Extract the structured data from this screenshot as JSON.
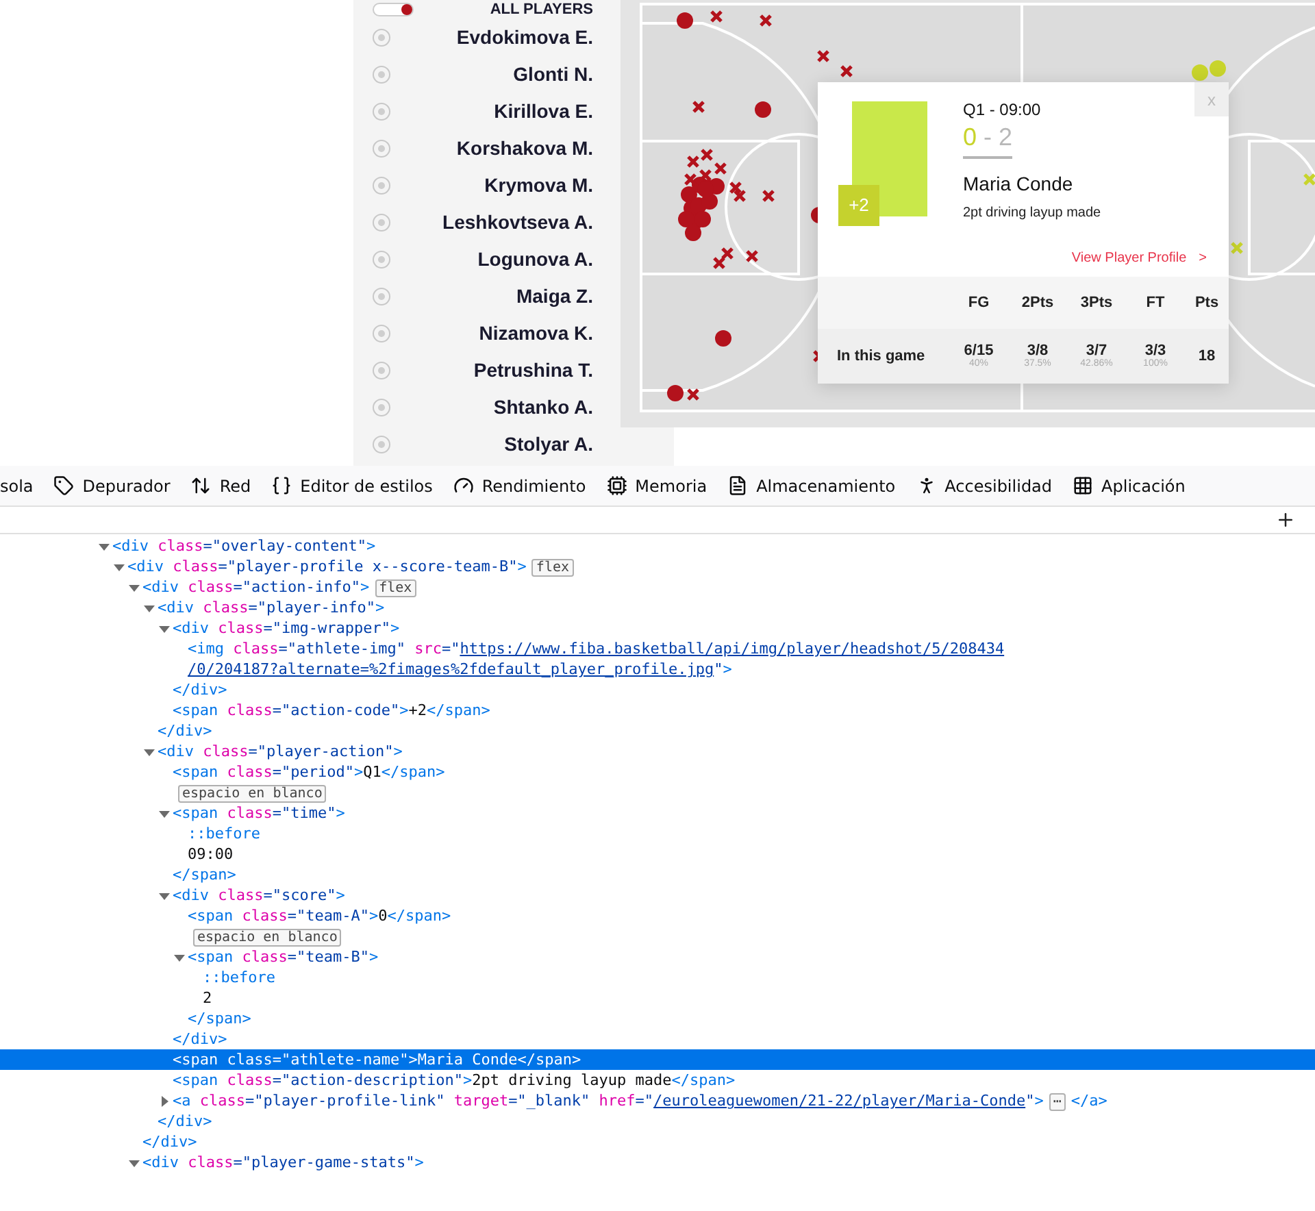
{
  "sidebar": {
    "all_players": {
      "label": "ALL PLAYERS",
      "on": true
    },
    "players": [
      {
        "name": "Evdokimova E.",
        "selected": false
      },
      {
        "name": "Glonti N.",
        "selected": false
      },
      {
        "name": "Kirillova E.",
        "selected": false
      },
      {
        "name": "Korshakova M.",
        "selected": false
      },
      {
        "name": "Krymova M.",
        "selected": false
      },
      {
        "name": "Leshkovtseva A.",
        "selected": false
      },
      {
        "name": "Logunova A.",
        "selected": false
      },
      {
        "name": "Maiga Z.",
        "selected": false
      },
      {
        "name": "Nizamova K.",
        "selected": false
      },
      {
        "name": "Petrushina T.",
        "selected": false
      },
      {
        "name": "Shtanko A.",
        "selected": false
      },
      {
        "name": "Stolyar A.",
        "selected": false
      }
    ]
  },
  "popup": {
    "close": "x",
    "period_time": "Q1 - 09:00",
    "score": {
      "team_a": "0",
      "separator": "-",
      "team_b": "2"
    },
    "action_code": "+2",
    "athlete_name": "Maria Conde",
    "description": "2pt driving layup made",
    "link": "View Player Profile",
    "link_arrow": ">",
    "stats": {
      "columns": [
        "FG",
        "2Pts",
        "3Pts",
        "FT",
        "Pts"
      ],
      "row_label": "In this game",
      "cells": [
        {
          "value": "6/15",
          "pct": "40%"
        },
        {
          "value": "3/8",
          "pct": "37.5%"
        },
        {
          "value": "3/7",
          "pct": "42.86%"
        },
        {
          "value": "3/3",
          "pct": "100%"
        },
        {
          "value": "18"
        }
      ]
    }
  },
  "devtools": {
    "tabs": [
      {
        "label": "sola"
      },
      {
        "label": "Depurador"
      },
      {
        "label": "Red"
      },
      {
        "label": "Editor de estilos"
      },
      {
        "label": "Rendimiento"
      },
      {
        "label": "Memoria"
      },
      {
        "label": "Almacenamiento"
      },
      {
        "label": "Accesibilidad"
      },
      {
        "label": "Aplicación"
      }
    ],
    "markup": {
      "expanded": true,
      "selected": false,
      "parts": [
        {
          "kind": "tag",
          "text": "<div"
        },
        {
          "kind": "attr",
          "text": " class"
        },
        {
          "kind": "value",
          "text": "=\"overlay-content\""
        },
        {
          "kind": "tag",
          "text": ">"
        }
      ],
      "children": [
        {
          "expanded": true,
          "selected": false,
          "parts": [
            {
              "kind": "tag",
              "text": "<div"
            },
            {
              "kind": "attr",
              "text": " class"
            },
            {
              "kind": "value",
              "text": "=\"player-profile x--score-team-B\""
            },
            {
              "kind": "tag",
              "text": ">"
            }
          ],
          "badge": "flex",
          "children": [
            {
              "expanded": true,
              "selected": false,
              "parts": [
                {
                  "kind": "tag",
                  "text": "<div"
                },
                {
                  "kind": "attr",
                  "text": " class"
                },
                {
                  "kind": "value",
                  "text": "=\"action-info\""
                },
                {
                  "kind": "tag",
                  "text": ">"
                }
              ],
              "badge": "flex",
              "children": [
                {
                  "expanded": true,
                  "selected": false,
                  "parts": [
                    {
                      "kind": "tag",
                      "text": "<div"
                    },
                    {
                      "kind": "attr",
                      "text": " class"
                    },
                    {
                      "kind": "value",
                      "text": "=\"player-info\""
                    },
                    {
                      "kind": "tag",
                      "text": ">"
                    }
                  ],
                  "children": [
                    {
                      "expanded": true,
                      "selected": false,
                      "parts": [
                        {
                          "kind": "tag",
                          "text": "<div"
                        },
                        {
                          "kind": "attr",
                          "text": " class"
                        },
                        {
                          "kind": "value",
                          "text": "=\"img-wrapper\""
                        },
                        {
                          "kind": "tag",
                          "text": ">"
                        }
                      ],
                      "children": [
                        {
                          "selected": false,
                          "parts": [
                            {
                              "kind": "tag",
                              "text": "<img"
                            },
                            {
                              "kind": "attr",
                              "text": " class"
                            },
                            {
                              "kind": "value",
                              "text": "=\"athlete-img\""
                            },
                            {
                              "kind": "attr",
                              "text": " src"
                            },
                            {
                              "kind": "value",
                              "text": "=\""
                            },
                            {
                              "kind": "link",
                              "text": "https://www.fiba.basketball/api/img/player/headshot/5/208434"
                            },
                            {
                              "kind": "link",
                              "new_line": true,
                              "text": "/0/204187?alternate=%2fimages%2fdefault_player_profile.jpg"
                            },
                            {
                              "kind": "value",
                              "text": "\""
                            },
                            {
                              "kind": "tag",
                              "text": ">"
                            }
                          ]
                        }
                      ],
                      "closing": {
                        "selected": false,
                        "parts": [
                          {
                            "kind": "tag",
                            "text": "</div>"
                          }
                        ]
                      }
                    },
                    {
                      "selected": false,
                      "parts": [
                        {
                          "kind": "tag",
                          "text": "<span"
                        },
                        {
                          "kind": "attr",
                          "text": " class"
                        },
                        {
                          "kind": "value",
                          "text": "=\"action-code\""
                        },
                        {
                          "kind": "tag",
                          "text": ">"
                        },
                        {
                          "kind": "text",
                          "text": "+2"
                        },
                        {
                          "kind": "tag",
                          "text": "</span>"
                        }
                      ]
                    }
                  ],
                  "closing": {
                    "selected": false,
                    "parts": [
                      {
                        "kind": "tag",
                        "text": "</div>"
                      }
                    ]
                  }
                },
                {
                  "expanded": true,
                  "selected": false,
                  "parts": [
                    {
                      "kind": "tag",
                      "text": "<div"
                    },
                    {
                      "kind": "attr",
                      "text": " class"
                    },
                    {
                      "kind": "value",
                      "text": "=\"player-action\""
                    },
                    {
                      "kind": "tag",
                      "text": ">"
                    }
                  ],
                  "children": [
                    {
                      "selected": false,
                      "parts": [
                        {
                          "kind": "tag",
                          "text": "<span"
                        },
                        {
                          "kind": "attr",
                          "text": " class"
                        },
                        {
                          "kind": "value",
                          "text": "=\"period\""
                        },
                        {
                          "kind": "tag",
                          "text": ">"
                        },
                        {
                          "kind": "text",
                          "text": "Q1"
                        },
                        {
                          "kind": "tag",
                          "text": "</span>"
                        }
                      ]
                    },
                    {
                      "selected": false,
                      "badge": "espacio en blanco"
                    },
                    {
                      "expanded": true,
                      "selected": false,
                      "parts": [
                        {
                          "kind": "tag",
                          "text": "<span"
                        },
                        {
                          "kind": "attr",
                          "text": " class"
                        },
                        {
                          "kind": "value",
                          "text": "=\"time\""
                        },
                        {
                          "kind": "tag",
                          "text": ">"
                        }
                      ],
                      "children": [
                        {
                          "selected": false,
                          "parts": [
                            {
                              "kind": "pseudo",
                              "text": "::before"
                            }
                          ]
                        },
                        {
                          "selected": false,
                          "parts": [
                            {
                              "kind": "text",
                              "text": "09:00"
                            }
                          ]
                        }
                      ],
                      "closing": {
                        "selected": false,
                        "parts": [
                          {
                            "kind": "tag",
                            "text": "</span>"
                          }
                        ]
                      }
                    },
                    {
                      "expanded": true,
                      "selected": false,
                      "parts": [
                        {
                          "kind": "tag",
                          "text": "<div"
                        },
                        {
                          "kind": "attr",
                          "text": " class"
                        },
                        {
                          "kind": "value",
                          "text": "=\"score\""
                        },
                        {
                          "kind": "tag",
                          "text": ">"
                        }
                      ],
                      "children": [
                        {
                          "selected": false,
                          "parts": [
                            {
                              "kind": "tag",
                              "text": "<span"
                            },
                            {
                              "kind": "attr",
                              "text": " class"
                            },
                            {
                              "kind": "value",
                              "text": "=\"team-A\""
                            },
                            {
                              "kind": "tag",
                              "text": ">"
                            },
                            {
                              "kind": "text",
                              "text": "0"
                            },
                            {
                              "kind": "tag",
                              "text": "</span>"
                            }
                          ]
                        },
                        {
                          "selected": false,
                          "badge": "espacio en blanco"
                        },
                        {
                          "expanded": true,
                          "selected": false,
                          "parts": [
                            {
                              "kind": "tag",
                              "text": "<span"
                            },
                            {
                              "kind": "attr",
                              "text": " class"
                            },
                            {
                              "kind": "value",
                              "text": "=\"team-B\""
                            },
                            {
                              "kind": "tag",
                              "text": ">"
                            }
                          ],
                          "children": [
                            {
                              "selected": false,
                              "parts": [
                                {
                                  "kind": "pseudo",
                                  "text": "::before"
                                }
                              ]
                            },
                            {
                              "selected": false,
                              "parts": [
                                {
                                  "kind": "text",
                                  "text": "2"
                                }
                              ]
                            }
                          ],
                          "closing": {
                            "selected": false,
                            "parts": [
                              {
                                "kind": "tag",
                                "text": "</span>"
                              }
                            ]
                          }
                        }
                      ],
                      "closing": {
                        "selected": false,
                        "parts": [
                          {
                            "kind": "tag",
                            "text": "</div>"
                          }
                        ]
                      }
                    },
                    {
                      "selected": true,
                      "parts": [
                        {
                          "kind": "tag",
                          "text": "<span"
                        },
                        {
                          "kind": "attr",
                          "text": " class"
                        },
                        {
                          "kind": "value",
                          "text": "=\"athlete-name\""
                        },
                        {
                          "kind": "tag",
                          "text": ">"
                        },
                        {
                          "kind": "text",
                          "text": "Maria Conde"
                        },
                        {
                          "kind": "tag",
                          "text": "</span>"
                        }
                      ]
                    },
                    {
                      "selected": false,
                      "parts": [
                        {
                          "kind": "tag",
                          "text": "<span"
                        },
                        {
                          "kind": "attr",
                          "text": " class"
                        },
                        {
                          "kind": "value",
                          "text": "=\"action-description\""
                        },
                        {
                          "kind": "tag",
                          "text": ">"
                        },
                        {
                          "kind": "text",
                          "text": "2pt driving layup made"
                        },
                        {
                          "kind": "tag",
                          "text": "</span>"
                        }
                      ]
                    },
                    {
                      "expanded": false,
                      "selected": false,
                      "parts": [
                        {
                          "kind": "tag",
                          "text": "<a"
                        },
                        {
                          "kind": "attr",
                          "text": " class"
                        },
                        {
                          "kind": "value",
                          "text": "=\"player-profile-link\""
                        },
                        {
                          "kind": "attr",
                          "text": " target"
                        },
                        {
                          "kind": "value",
                          "text": "=\"_blank\""
                        },
                        {
                          "kind": "attr",
                          "text": " href"
                        },
                        {
                          "kind": "value",
                          "text": "=\""
                        },
                        {
                          "kind": "link",
                          "text": "/euroleaguewomen/21-22/player/Maria-Conde"
                        },
                        {
                          "kind": "value",
                          "text": "\""
                        },
                        {
                          "kind": "tag",
                          "text": ">"
                        }
                      ],
                      "badge": "⋯",
                      "tail": [
                        {
                          "kind": "tag",
                          "text": "</a>"
                        }
                      ]
                    }
                  ],
                  "closing": {
                    "selected": false,
                    "parts": [
                      {
                        "kind": "tag",
                        "text": "</div>"
                      }
                    ]
                  }
                }
              ],
              "closing": {
                "selected": false,
                "parts": [
                  {
                    "kind": "tag",
                    "text": "</div>"
                  }
                ]
              }
            },
            {
              "expanded": true,
              "selected": false,
              "parts": [
                {
                  "kind": "tag",
                  "text": "<div"
                },
                {
                  "kind": "attr",
                  "text": " class"
                },
                {
                  "kind": "value",
                  "text": "=\"player-game-stats\""
                },
                {
                  "kind": "tag",
                  "text": ">"
                }
              ]
            }
          ]
        }
      ]
    }
  }
}
